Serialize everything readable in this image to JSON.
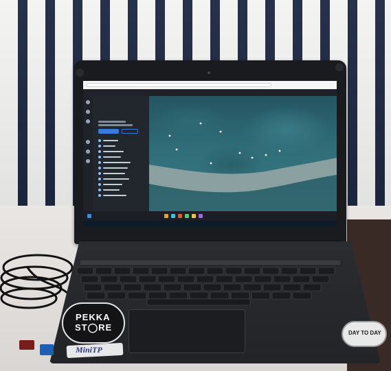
{
  "scene": {
    "wall_colors": [
      "#f3f3f1",
      "#1b2740"
    ],
    "laptop_color": "#232428",
    "table_color": "#e2dfdc"
  },
  "screen": {
    "app": {
      "header_left": "",
      "header_right_1": "",
      "header_right_2": "",
      "project_title": ""
    },
    "map_labels": [
      "",
      "",
      "",
      "",
      ""
    ]
  },
  "stickers": {
    "pekka_line1": "PEKKA",
    "pekka_line2": "ST◯RE",
    "mini_brand": "MiniTP",
    "day_to_day": "DAY TO DAY"
  }
}
